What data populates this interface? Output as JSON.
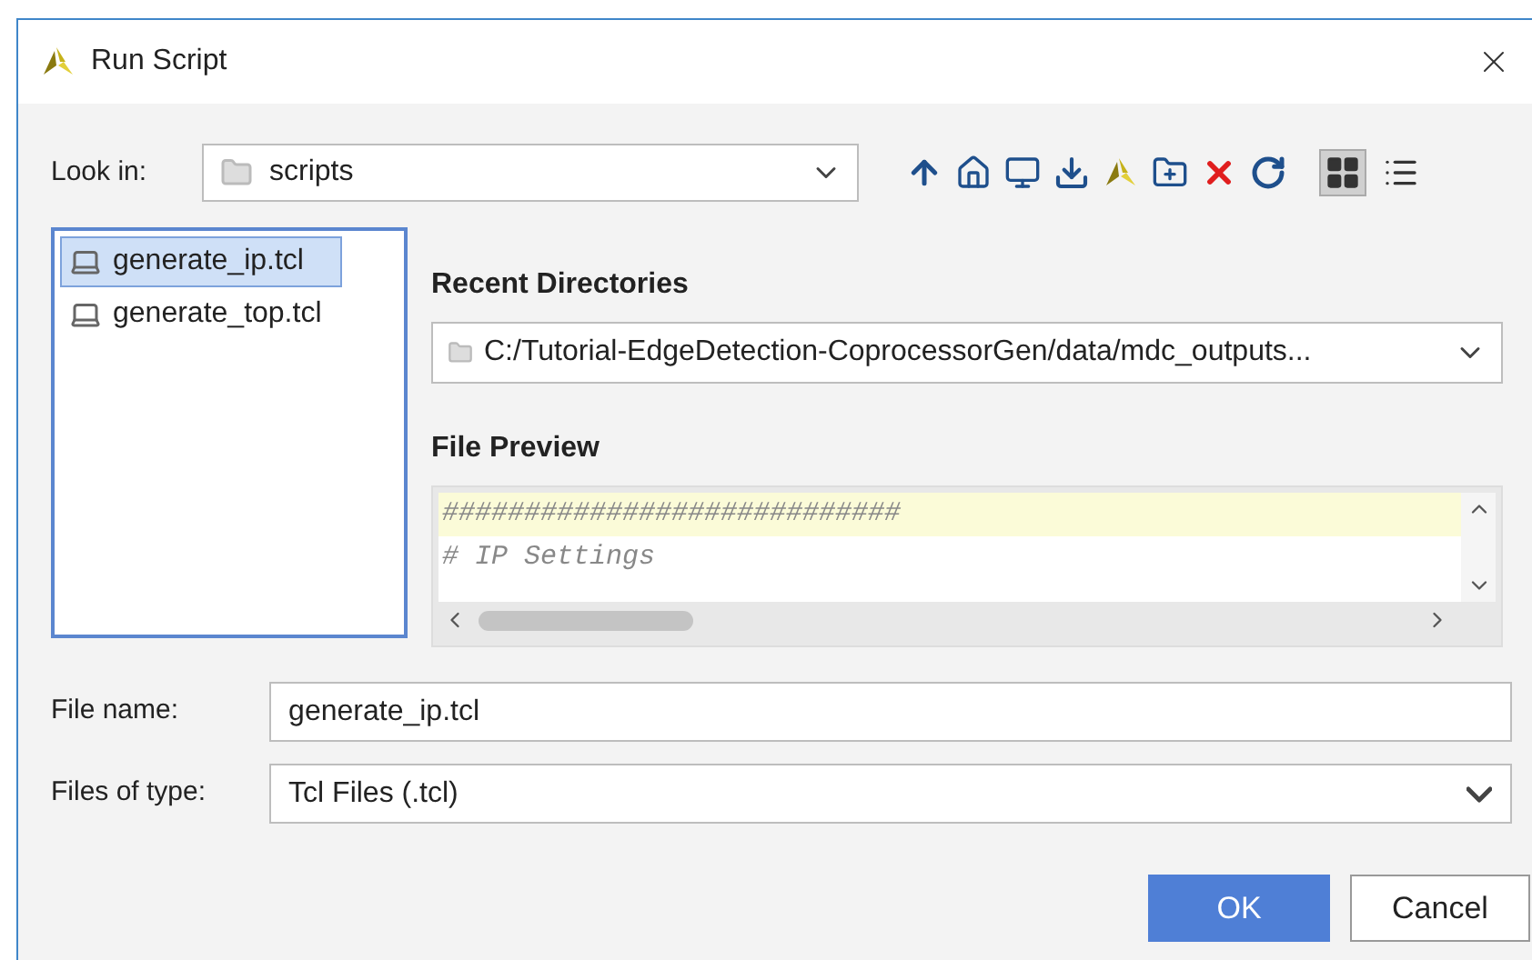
{
  "window": {
    "title": "Run Script"
  },
  "look_in": {
    "label": "Look in:",
    "value": "scripts"
  },
  "toolbar": [
    {
      "kind": "up"
    },
    {
      "kind": "home"
    },
    {
      "kind": "desktop"
    },
    {
      "kind": "download"
    },
    {
      "kind": "logo"
    },
    {
      "kind": "newfolder"
    },
    {
      "kind": "delete"
    },
    {
      "kind": "refresh"
    }
  ],
  "views": [
    {
      "kind": "grid",
      "selected": true
    },
    {
      "kind": "list",
      "selected": false
    }
  ],
  "files": [
    {
      "name": "generate_ip.tcl",
      "selected": true
    },
    {
      "name": "generate_top.tcl",
      "selected": false
    }
  ],
  "recent_directories": {
    "title": "Recent Directories",
    "value": "C:/Tutorial-EdgeDetection-CoprocessorGen/data/mdc_outputs..."
  },
  "file_preview": {
    "title": "File Preview",
    "lines": [
      {
        "text": "############################",
        "selected": true
      },
      {
        "text": "# IP Settings",
        "selected": false
      }
    ]
  },
  "file_name": {
    "label": "File name:",
    "value": "generate_ip.tcl"
  },
  "files_of_type": {
    "label": "Files of type:",
    "value": "Tcl Files (.tcl)"
  },
  "buttons": [
    {
      "label": "OK",
      "kind": "primary"
    },
    {
      "label": "Cancel",
      "kind": "secondary"
    }
  ]
}
